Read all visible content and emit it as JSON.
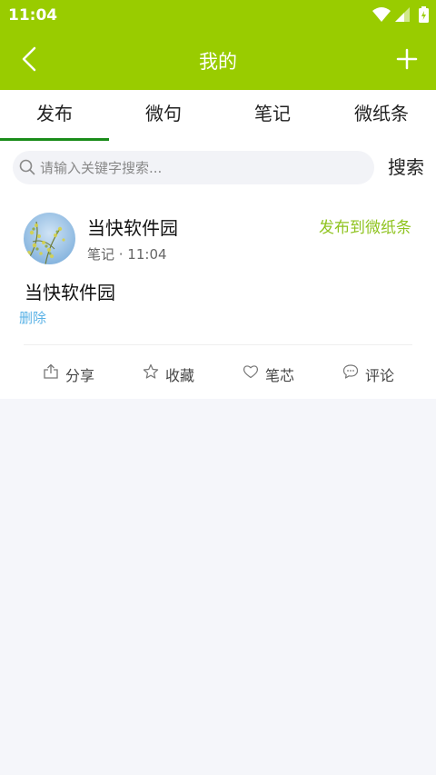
{
  "status_bar": {
    "time": "11:04"
  },
  "header": {
    "title": "我的"
  },
  "tabs": [
    {
      "label": "发布",
      "active": true
    },
    {
      "label": "微句",
      "active": false
    },
    {
      "label": "笔记",
      "active": false
    },
    {
      "label": "微纸条",
      "active": false
    }
  ],
  "search": {
    "placeholder": "请输入关键字搜索...",
    "value": "",
    "button_label": "搜索"
  },
  "post": {
    "author": "当快软件园",
    "category": "笔记",
    "time": "11:04",
    "meta": "笔记 · 11:04",
    "publish_label": "发布到微纸条",
    "content": "当快软件园",
    "delete_label": "删除",
    "actions": [
      {
        "label": "分享",
        "icon": "share-icon"
      },
      {
        "label": "收藏",
        "icon": "star-icon"
      },
      {
        "label": "笔芯",
        "icon": "heart-icon"
      },
      {
        "label": "评论",
        "icon": "comment-icon"
      }
    ]
  },
  "colors": {
    "app_bar": "#99cc00",
    "tab_indicator": "#1a8c1a",
    "publish_link": "#8fc31f",
    "delete_link": "#5ab2e6",
    "background": "#f5f6fa"
  }
}
